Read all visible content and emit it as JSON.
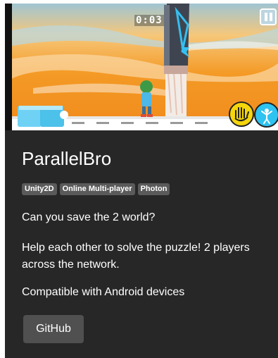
{
  "game": {
    "timer": "0:03"
  },
  "project": {
    "title": "ParallelBro",
    "tags": [
      "Unity2D",
      "Online Multi-player",
      "Photon"
    ],
    "tagline": "Can you save the 2 world?",
    "description": "Help each other to solve the puzzle! 2 players across the network.",
    "compatibility": "Compatible with Android devices",
    "github_label": "GitHub"
  },
  "colors": {
    "card_bg": "#272727",
    "tag_bg": "#5a5a5a",
    "button_bg": "#505050",
    "sky_orange": "#f49a26",
    "accent_yellow": "#f5d60c",
    "accent_cyan": "#2ec3f1"
  },
  "icons": [
    "pause-icon",
    "hand-icon",
    "jump-icon"
  ]
}
